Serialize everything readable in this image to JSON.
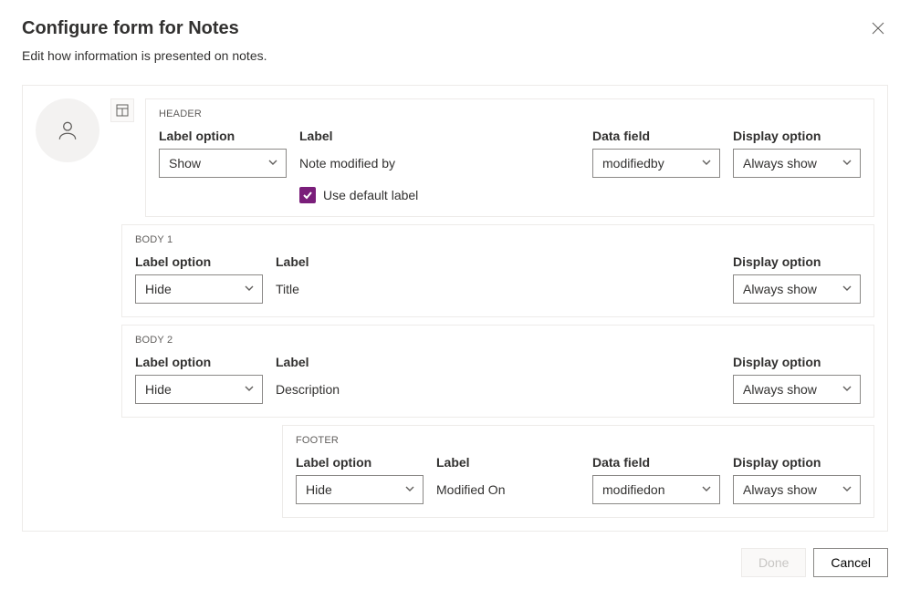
{
  "dialog": {
    "title": "Configure form for Notes",
    "subtitle": "Edit how information is presented on notes."
  },
  "labels": {
    "label_option": "Label option",
    "label": "Label",
    "data_field": "Data field",
    "display_option": "Display option",
    "use_default_label": "Use default label"
  },
  "sections": {
    "header": {
      "name": "HEADER",
      "label_option": "Show",
      "label_value": "Note modified by",
      "use_default_checked": true,
      "data_field": "modifiedby",
      "display_option": "Always show"
    },
    "body1": {
      "name": "BODY 1",
      "label_option": "Hide",
      "label_value": "Title",
      "display_option": "Always show"
    },
    "body2": {
      "name": "BODY 2",
      "label_option": "Hide",
      "label_value": "Description",
      "display_option": "Always show"
    },
    "footer": {
      "name": "FOOTER",
      "label_option": "Hide",
      "label_value": "Modified On",
      "data_field": "modifiedon",
      "display_option": "Always show"
    }
  },
  "buttons": {
    "done": "Done",
    "cancel": "Cancel"
  }
}
